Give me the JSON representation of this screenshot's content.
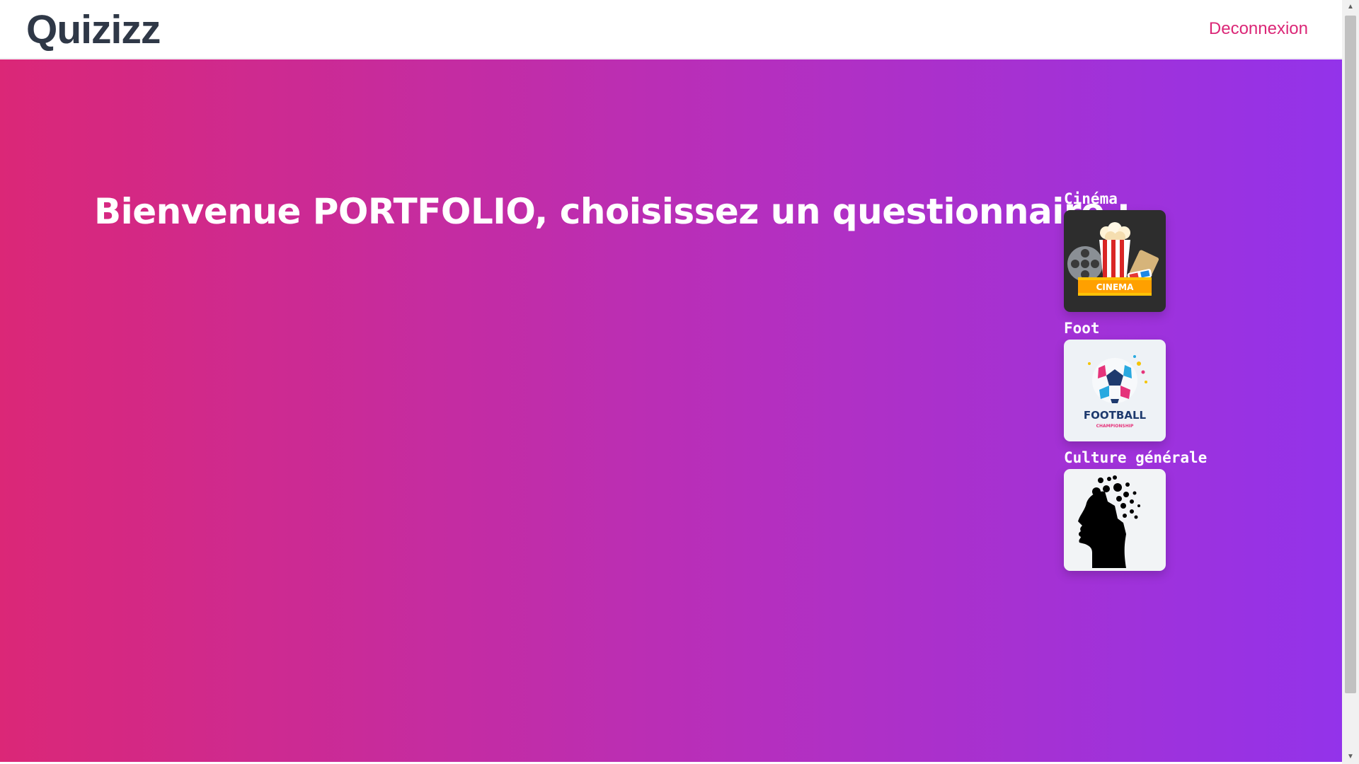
{
  "header": {
    "brand": "Quizizz",
    "logout_label": "Deconnexion"
  },
  "main": {
    "welcome_text": "Bienvenue PORTFOLIO, choisissez un questionnaire :"
  },
  "quizzes": [
    {
      "title": "Cinéma",
      "image_label": "CINEMA",
      "icon": "cinema-icon"
    },
    {
      "title": "Foot",
      "image_label": "FOOTBALL",
      "image_sublabel": "CHAMPIONSHIP",
      "icon": "football-icon"
    },
    {
      "title": "Culture générale",
      "icon": "head-icon"
    }
  ],
  "colors": {
    "brand": "#2f3847",
    "accent": "#db2777",
    "gradient_start": "#db2777",
    "gradient_end": "#9333ea"
  }
}
